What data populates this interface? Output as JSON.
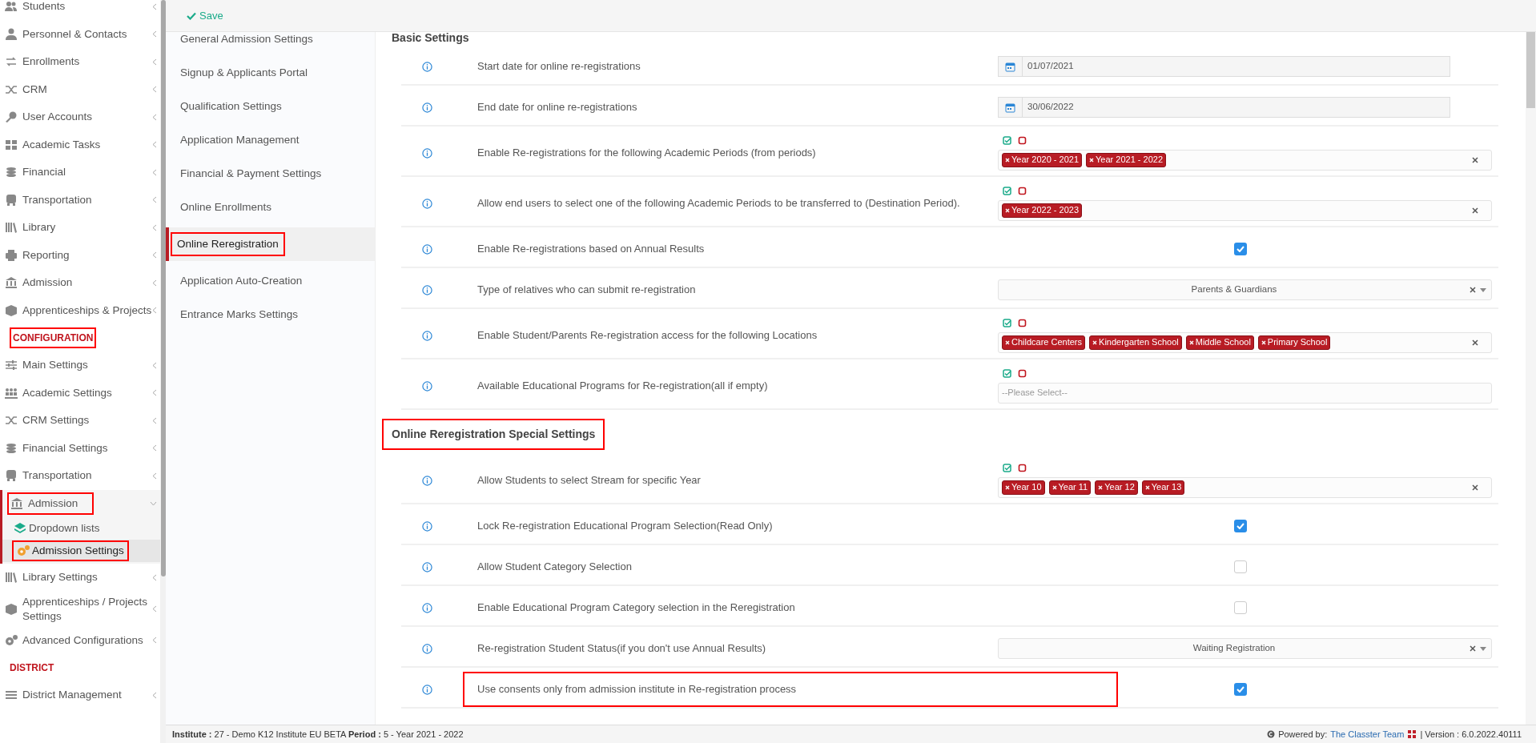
{
  "sidebar": [
    {
      "kind": "item",
      "label": "Students",
      "selected": false,
      "annotated": false,
      "expanded": false
    },
    {
      "kind": "item",
      "label": "Personnel & Contacts",
      "selected": false,
      "annotated": false,
      "expanded": false
    },
    {
      "kind": "item",
      "label": "Enrollments",
      "selected": false,
      "annotated": false,
      "expanded": false
    },
    {
      "kind": "item",
      "label": "CRM",
      "selected": false,
      "annotated": false,
      "expanded": false
    },
    {
      "kind": "item",
      "label": "User Accounts",
      "selected": false,
      "annotated": false,
      "expanded": false
    },
    {
      "kind": "item",
      "label": "Academic Tasks",
      "selected": false,
      "annotated": false,
      "expanded": false
    },
    {
      "kind": "item",
      "label": "Financial",
      "selected": false,
      "annotated": false,
      "expanded": false
    },
    {
      "kind": "item",
      "label": "Transportation",
      "selected": false,
      "annotated": false,
      "expanded": false
    },
    {
      "kind": "item",
      "label": "Library",
      "selected": false,
      "annotated": false,
      "expanded": false
    },
    {
      "kind": "item",
      "label": "Reporting",
      "selected": false,
      "annotated": false,
      "expanded": false
    },
    {
      "kind": "item",
      "label": "Admission",
      "selected": false,
      "annotated": false,
      "expanded": false
    },
    {
      "kind": "item",
      "label": "Apprenticeships & Projects",
      "selected": false,
      "annotated": false,
      "expanded": false
    },
    {
      "kind": "header",
      "label": "CONFIGURATION",
      "annotated": true
    },
    {
      "kind": "item",
      "label": "Main Settings",
      "selected": false,
      "annotated": false,
      "expanded": false
    },
    {
      "kind": "item",
      "label": "Academic Settings",
      "selected": false,
      "annotated": false,
      "expanded": false
    },
    {
      "kind": "item",
      "label": "CRM Settings",
      "selected": false,
      "annotated": false,
      "expanded": false
    },
    {
      "kind": "item",
      "label": "Financial Settings",
      "selected": false,
      "annotated": false,
      "expanded": false
    },
    {
      "kind": "item",
      "label": "Transportation",
      "selected": false,
      "annotated": false,
      "expanded": false
    },
    {
      "kind": "item",
      "label": "Admission",
      "selected": false,
      "annotated": true,
      "expanded": true,
      "children": [
        {
          "label": "Dropdown lists",
          "selected": false,
          "annotated": false
        },
        {
          "label": "Admission Settings",
          "selected": true,
          "annotated": true
        }
      ]
    },
    {
      "kind": "item",
      "label": "Library Settings",
      "selected": false,
      "annotated": false,
      "expanded": false
    },
    {
      "kind": "item",
      "label": "Apprenticeships / Projects Settings",
      "selected": false,
      "annotated": false,
      "expanded": false
    },
    {
      "kind": "item",
      "label": "Advanced Configurations",
      "selected": false,
      "annotated": false,
      "expanded": false
    },
    {
      "kind": "header",
      "label": "DISTRICT",
      "annotated": false
    },
    {
      "kind": "item",
      "label": "District Management",
      "selected": false,
      "annotated": false,
      "expanded": false
    }
  ],
  "toolbar": {
    "save": "Save"
  },
  "settings_nav": [
    {
      "label": "General Admission Settings",
      "selected": false,
      "annotated": false
    },
    {
      "label": "Signup & Applicants Portal",
      "selected": false,
      "annotated": false
    },
    {
      "label": "Qualification Settings",
      "selected": false,
      "annotated": false
    },
    {
      "label": "Application Management",
      "selected": false,
      "annotated": false
    },
    {
      "label": "Financial & Payment Settings",
      "selected": false,
      "annotated": false
    },
    {
      "label": "Online Enrollments",
      "selected": false,
      "annotated": false
    },
    {
      "label": "Online Reregistration",
      "selected": true,
      "annotated": true
    },
    {
      "label": "Application Auto-Creation",
      "selected": false,
      "annotated": false
    },
    {
      "label": "Entrance Marks Settings",
      "selected": false,
      "annotated": false
    }
  ],
  "sections": [
    {
      "title": "Basic Settings",
      "annotated": false,
      "rows": [
        {
          "kind": "date",
          "label": "Start date for online re-registrations",
          "value": "01/07/2021",
          "annotated": false
        },
        {
          "kind": "date",
          "label": "End date for online re-registrations",
          "value": "30/06/2022",
          "annotated": false
        },
        {
          "kind": "tags",
          "label": "Enable Re-registrations for the following Academic Periods (from periods)",
          "tags": [
            "Year 2020 - 2021",
            "Year 2021 - 2022"
          ],
          "annotated": false
        },
        {
          "kind": "tags",
          "label": "Allow end users to select one of the following Academic Periods to be transferred to (Destination Period).",
          "tags": [
            "Year 2022 - 2023"
          ],
          "annotated": false
        },
        {
          "kind": "checkbox",
          "label": "Enable Re-registrations based on Annual Results",
          "checked": true,
          "annotated": false
        },
        {
          "kind": "select",
          "label": "Type of relatives who can submit re-registration",
          "value": "Parents & Guardians",
          "annotated": false
        },
        {
          "kind": "tags",
          "label": "Enable Student/Parents Re-registration access for the following Locations",
          "tags": [
            "Childcare Centers",
            "Kindergarten School",
            "Middle School",
            "Primary School"
          ],
          "annotated": false
        },
        {
          "kind": "tags",
          "label": "Available Educational Programs for Re-registration(all if empty)",
          "placeholder": "--Please Select--",
          "annotated": false
        }
      ]
    },
    {
      "title": "Online Reregistration Special Settings",
      "annotated": true,
      "rows": [
        {
          "kind": "tags",
          "label": "Allow Students to select Stream for specific Year",
          "tags": [
            "Year 10",
            "Year 11",
            "Year 12",
            "Year 13"
          ],
          "annotated": false
        },
        {
          "kind": "checkbox",
          "label": "Lock Re-registration Educational Program Selection(Read Only)",
          "checked": true,
          "annotated": false
        },
        {
          "kind": "checkbox",
          "label": "Allow Student Category Selection",
          "checked": false,
          "annotated": false
        },
        {
          "kind": "checkbox",
          "label": "Enable Educational Program Category selection in the Reregistration",
          "checked": false,
          "annotated": false
        },
        {
          "kind": "select",
          "label": "Re-registration Student Status(if you don't use Annual Results)",
          "value": "Waiting Registration",
          "annotated": false
        },
        {
          "kind": "checkbox",
          "label": "Use consents only from admission institute in Re-registration process",
          "checked": true,
          "annotated": true
        }
      ]
    }
  ],
  "footer": {
    "info": "**Institute :** 27 - Demo K12 Institute EU BETA **Period :** 5 - Year 2021 - 2022",
    "powered_by": "Powered by:",
    "link": "The Classter Team",
    "version": "| Version : 6.0.2022.40111"
  }
}
